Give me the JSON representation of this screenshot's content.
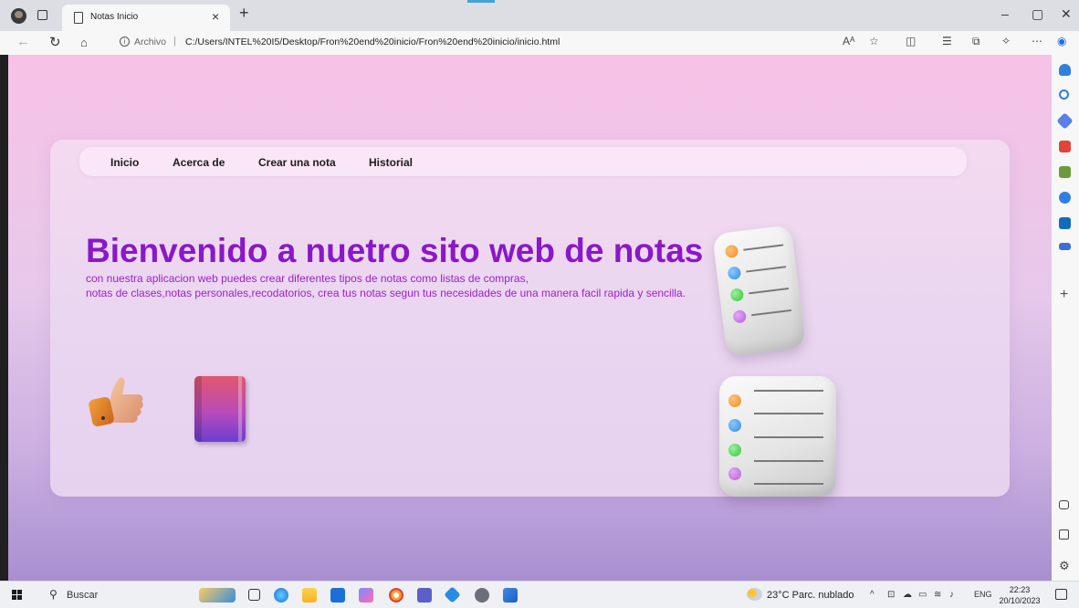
{
  "browser": {
    "tab_title": "Notas Inicio",
    "tab_close": "×",
    "new_tab": "+",
    "url_label": "Archivo",
    "url_separator": "|",
    "url": "C:/Users/INTEL%20I5/Desktop/Fron%20end%20inicio/Fron%20end%20inicio/inicio.html",
    "window_minimize": "–",
    "window_restore": "▢",
    "window_close": "✕"
  },
  "page": {
    "nav": [
      "Inicio",
      "Acerca de",
      "Crear una nota",
      "Historial"
    ],
    "hero_title": "Bienvenido a nuetro sito web de notas",
    "hero_text_line1": "con nuestra aplicacion web puedes crear diferentes tipos de notas como listas de compras,",
    "hero_text_line2": "notas de clases,notas personales,recodatorios, crea tus notas segun tus necesidades de una manera facil rapida y sencilla."
  },
  "colors": {
    "accent": "#8a17c9",
    "dot_orange": "#f08a24",
    "dot_blue": "#2f8ddc",
    "dot_green": "#3bbf3b",
    "dot_purple": "#b45dd8"
  },
  "taskbar": {
    "search_label": "Buscar",
    "weather": "23°C  Parc. nublado",
    "language": "ENG",
    "time": "22:23",
    "date": "20/10/2023"
  }
}
